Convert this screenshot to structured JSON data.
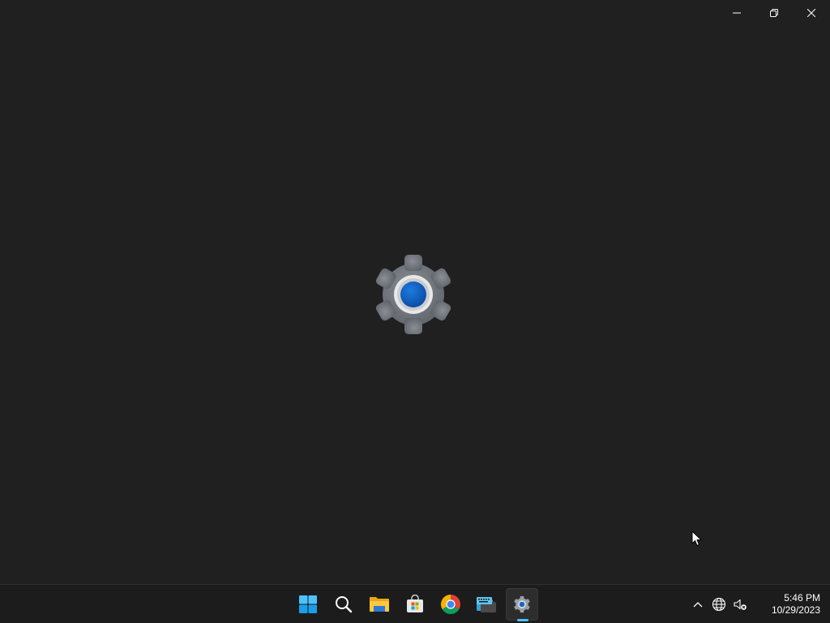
{
  "window": {
    "caption_buttons": [
      {
        "name": "minimize",
        "icon": "minimize-icon"
      },
      {
        "name": "restore",
        "icon": "restore-icon"
      },
      {
        "name": "close",
        "icon": "close-icon"
      }
    ],
    "splash_icon": "settings-gear-icon",
    "accent_color": "#0067c0"
  },
  "taskbar": {
    "apps": [
      {
        "name": "start",
        "icon": "windows-logo-icon"
      },
      {
        "name": "search",
        "icon": "search-icon"
      },
      {
        "name": "file-explorer",
        "icon": "folder-icon"
      },
      {
        "name": "microsoft-store",
        "icon": "store-icon"
      },
      {
        "name": "chrome",
        "icon": "chrome-icon"
      },
      {
        "name": "touch-keyboard",
        "icon": "keyboard-icon"
      },
      {
        "name": "settings",
        "icon": "gear-icon",
        "active": true
      }
    ],
    "tray": {
      "icons": [
        "chevron-up-icon",
        "globe-icon",
        "speaker-muted-icon"
      ],
      "time": "5:46 PM",
      "date": "10/29/2023"
    },
    "indicator_color": "#4cc2ff"
  }
}
